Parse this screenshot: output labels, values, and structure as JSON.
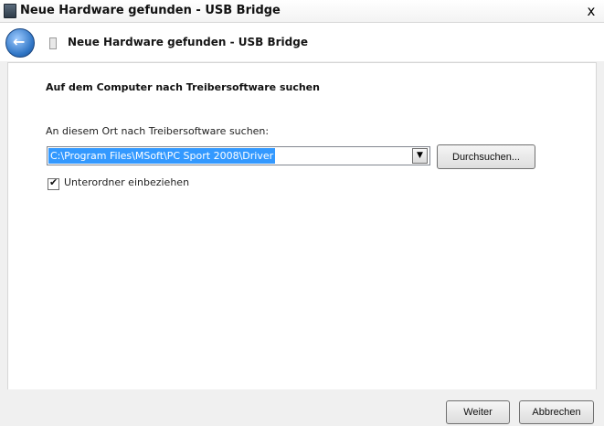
{
  "window": {
    "title": "Neue Hardware gefunden - USB Bridge",
    "close_label": "x"
  },
  "navbar": {
    "title": "Neue Hardware gefunden - USB Bridge",
    "back_label": "←"
  },
  "content": {
    "heading": "Auf dem Computer nach Treibersoftware suchen",
    "location_label": "An diesem Ort nach Treibersoftware suchen:",
    "path_value": "C:\\Program Files\\MSoft\\PC Sport 2008\\Driver",
    "dropdown_arrow": "▼",
    "browse_label": "Durchsuchen...",
    "checkbox": {
      "checked": true,
      "mark": "✔",
      "label": "Unterordner einbeziehen"
    }
  },
  "footer": {
    "next_label": "Weiter",
    "cancel_label": "Abbrechen"
  },
  "colors": {
    "selection": "#3399ff",
    "back_button": "#2f75c5"
  }
}
